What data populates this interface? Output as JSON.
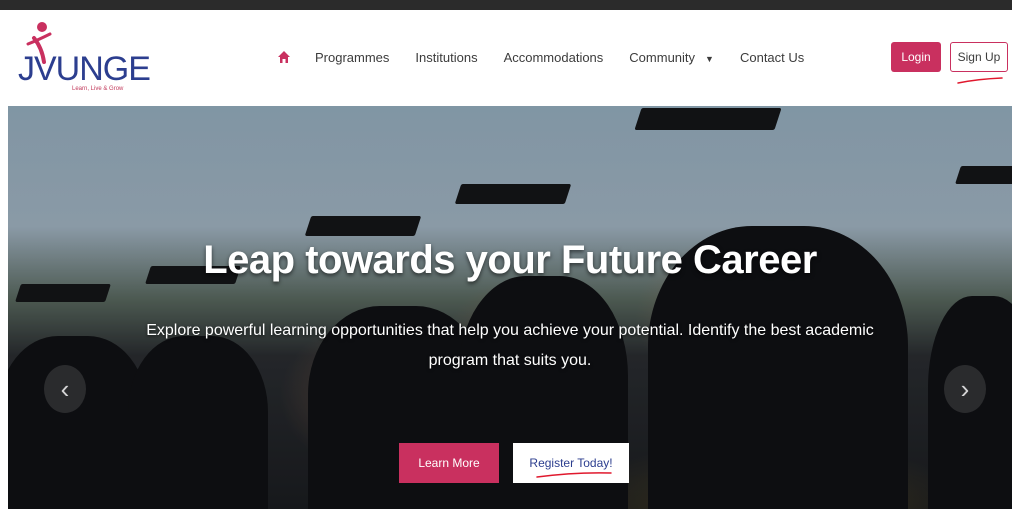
{
  "logo": {
    "text": "JVUNGE",
    "tagline": "Learn, Live & Grow"
  },
  "nav": {
    "home_icon": "home-icon",
    "items": [
      {
        "label": "Programmes"
      },
      {
        "label": "Institutions"
      },
      {
        "label": "Accommodations"
      },
      {
        "label": "Community",
        "has_dropdown": true
      },
      {
        "label": "Contact Us"
      }
    ]
  },
  "auth": {
    "login_label": "Login",
    "signup_label": "Sign Up"
  },
  "hero": {
    "title": "Leap towards your Future Career",
    "subtitle": "Explore powerful learning opportunities that help you achieve your potential. Identify the best academic program that suits you.",
    "learn_more_label": "Learn More",
    "register_label": "Register Today!",
    "prev_arrow": "‹",
    "next_arrow": "›"
  },
  "colors": {
    "accent": "#c9305f",
    "brand_blue": "#2c3e8f",
    "annotation_red": "#e0182d"
  }
}
